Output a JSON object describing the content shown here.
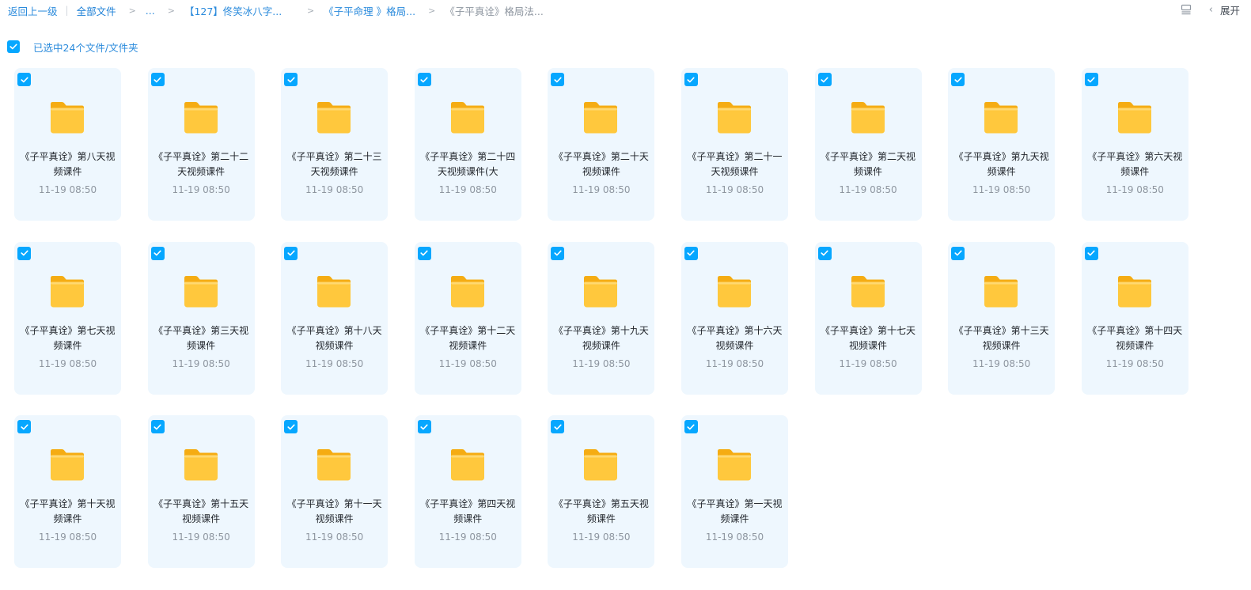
{
  "breadcrumb": {
    "back": "返回上一级",
    "all_files": "全部文件",
    "ellipsis": "...",
    "items": [
      "【127】佟笑冰八字...",
      "《子平命理 》格局...",
      "《子平真诠》格局法..."
    ]
  },
  "topbar": {
    "view_icon": "list-view-icon",
    "collapse_icon": "chevron-left-icon",
    "expand_label": "展开"
  },
  "selection": {
    "label": "已选中24个文件/文件夹",
    "all_checked": true
  },
  "colors": {
    "accent": "#06a7ff",
    "card_bg": "#eef7fe",
    "folder_main": "#ffc83d",
    "folder_back": "#f5ac13"
  },
  "folders": [
    {
      "name": "《子平真诠》第八天视频课件",
      "date": "11-19 08:50",
      "checked": true
    },
    {
      "name": "《子平真诠》第二十二天视频课件",
      "date": "11-19 08:50",
      "checked": true
    },
    {
      "name": "《子平真诠》第二十三天视频课件",
      "date": "11-19 08:50",
      "checked": true
    },
    {
      "name": "《子平真诠》第二十四天视频课件(大",
      "date": "11-19 08:50",
      "checked": true
    },
    {
      "name": "《子平真诠》第二十天视频课件",
      "date": "11-19 08:50",
      "checked": true
    },
    {
      "name": "《子平真诠》第二十一天视频课件",
      "date": "11-19 08:50",
      "checked": true
    },
    {
      "name": "《子平真诠》第二天视频课件",
      "date": "11-19 08:50",
      "checked": true
    },
    {
      "name": "《子平真诠》第九天视频课件",
      "date": "11-19 08:50",
      "checked": true
    },
    {
      "name": "《子平真诠》第六天视频课件",
      "date": "11-19 08:50",
      "checked": true
    },
    {
      "name": "《子平真诠》第七天视频课件",
      "date": "11-19 08:50",
      "checked": true
    },
    {
      "name": "《子平真诠》第三天视频课件",
      "date": "11-19 08:50",
      "checked": true
    },
    {
      "name": "《子平真诠》第十八天视频课件",
      "date": "11-19 08:50",
      "checked": true
    },
    {
      "name": "《子平真诠》第十二天视频课件",
      "date": "11-19 08:50",
      "checked": true
    },
    {
      "name": "《子平真诠》第十九天视频课件",
      "date": "11-19 08:50",
      "checked": true
    },
    {
      "name": "《子平真诠》第十六天视频课件",
      "date": "11-19 08:50",
      "checked": true
    },
    {
      "name": "《子平真诠》第十七天视频课件",
      "date": "11-19 08:50",
      "checked": true
    },
    {
      "name": "《子平真诠》第十三天视频课件",
      "date": "11-19 08:50",
      "checked": true
    },
    {
      "name": "《子平真诠》第十四天视频课件",
      "date": "11-19 08:50",
      "checked": true
    },
    {
      "name": "《子平真诠》第十天视频课件",
      "date": "11-19 08:50",
      "checked": true
    },
    {
      "name": "《子平真诠》第十五天视频课件",
      "date": "11-19 08:50",
      "checked": true
    },
    {
      "name": "《子平真诠》第十一天视频课件",
      "date": "11-19 08:50",
      "checked": true
    },
    {
      "name": "《子平真诠》第四天视频课件",
      "date": "11-19 08:50",
      "checked": true
    },
    {
      "name": "《子平真诠》第五天视频课件",
      "date": "11-19 08:50",
      "checked": true
    },
    {
      "name": "《子平真诠》第一天视频课件",
      "date": "11-19 08:50",
      "checked": true
    }
  ]
}
